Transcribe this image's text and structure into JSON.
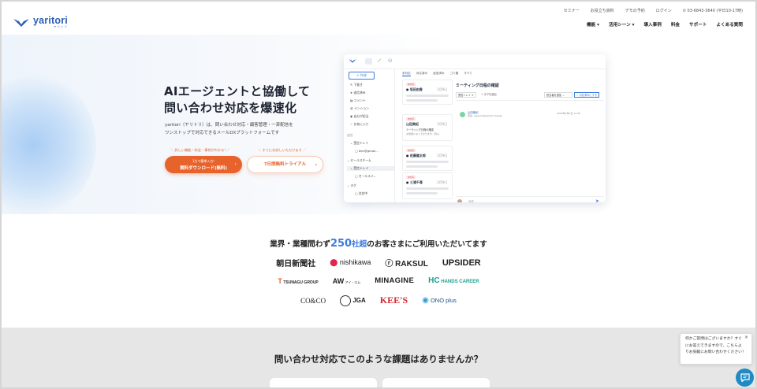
{
  "brand": {
    "name": "yaritori",
    "sub": "ヤリトリ",
    "color": "#2a5fb8"
  },
  "util_nav": [
    "セミナー",
    "お役立ち資料",
    "デモの予約",
    "ログイン",
    "03-6843-3640 (平日10-17時)"
  ],
  "main_nav": [
    "機能",
    "活用シーン",
    "導入事例",
    "料金",
    "サポート",
    "よくある質問"
  ],
  "hero": {
    "title_line1": "AIエージェントと協働して",
    "title_line2": "問い合わせ対応を爆速化",
    "desc_line1": "yaritori（ヤリトリ）は、問い合わせ対応・顧客管理・一斉配信を",
    "desc_line2": "ワンストップで対応できるメールDXプラットフォームです",
    "bubble_left": "詳しい機能・料金・事例がわかる!",
    "bubble_right": "すぐにお試しいただけます",
    "cta_primary_small": "1分で簡単入力!",
    "cta_primary": "資料ダウンロード(無料)",
    "cta_secondary": "7日間無料トライアル",
    "accent": "#e8632c"
  },
  "mock": {
    "new_button": "+ 作成",
    "sidebar": [
      "下書き",
      "送信済み",
      "コメント",
      "メンション",
      "自分が担当",
      "お気に入り",
      "自分",
      "受信トレイ",
      "dev@gmail...",
      "セールスチーム",
      "受信トレイ",
      "セールスメ...",
      "タグ",
      "対応中"
    ],
    "tabs": [
      "未対応",
      "対応済み",
      "返信済み",
      "ゴミ箱",
      "すべて"
    ],
    "cards": [
      {
        "tag": "未対応",
        "title": "坂田由香",
        "time": "1月9日"
      },
      {
        "tag": "未対応",
        "title": "山田美紀",
        "time": "1月9日",
        "line1": "ミーティング日程の確認",
        "line2": "お世話になっております。田山..."
      },
      {
        "tag": "未対応",
        "title": "佐藤健太郎",
        "time": "1月9日"
      },
      {
        "tag": "未対応",
        "title": "三浦千尋",
        "time": "1月9日"
      }
    ],
    "detail_title": "ミーティング日程の確認",
    "detail_inbox": "受信トレイ",
    "detail_tag": "+ タグを追加",
    "detail_assignee": "担当者を追加",
    "detail_status": "対応済みにする",
    "detail_sender": "山田美紀",
    "detail_email": "宛先: support@yaritori.design",
    "detail_date": "2024年1月9日 12:39",
    "reply_placeholder": "返信"
  },
  "trust": {
    "title_prefix": "業界・業種問わず",
    "title_num": "250",
    "title_unit": "社超",
    "title_suffix": "のお客さまにご利用いただいてます",
    "logos_row1": [
      "朝日新聞社",
      "nishikawa",
      "RAKSUL",
      "UPSIDER"
    ],
    "logos_row2": [
      "TSUNAGU GROUP",
      "アイ・エム",
      "MINAGINE",
      "HANDS CAREER"
    ],
    "logos_row3": [
      "CO&CO",
      "JGA",
      "KEE'S",
      "ONO plus"
    ]
  },
  "problem": {
    "title": "問い合わせ対応でこのような課題はありませんか？"
  },
  "chat": {
    "message_line1": "何かご質問はございますか？すぐ",
    "message_line2": "にお答えできますので、こちらよ",
    "message_line3": "りお気軽にお問い合わせください！",
    "close": "×"
  }
}
